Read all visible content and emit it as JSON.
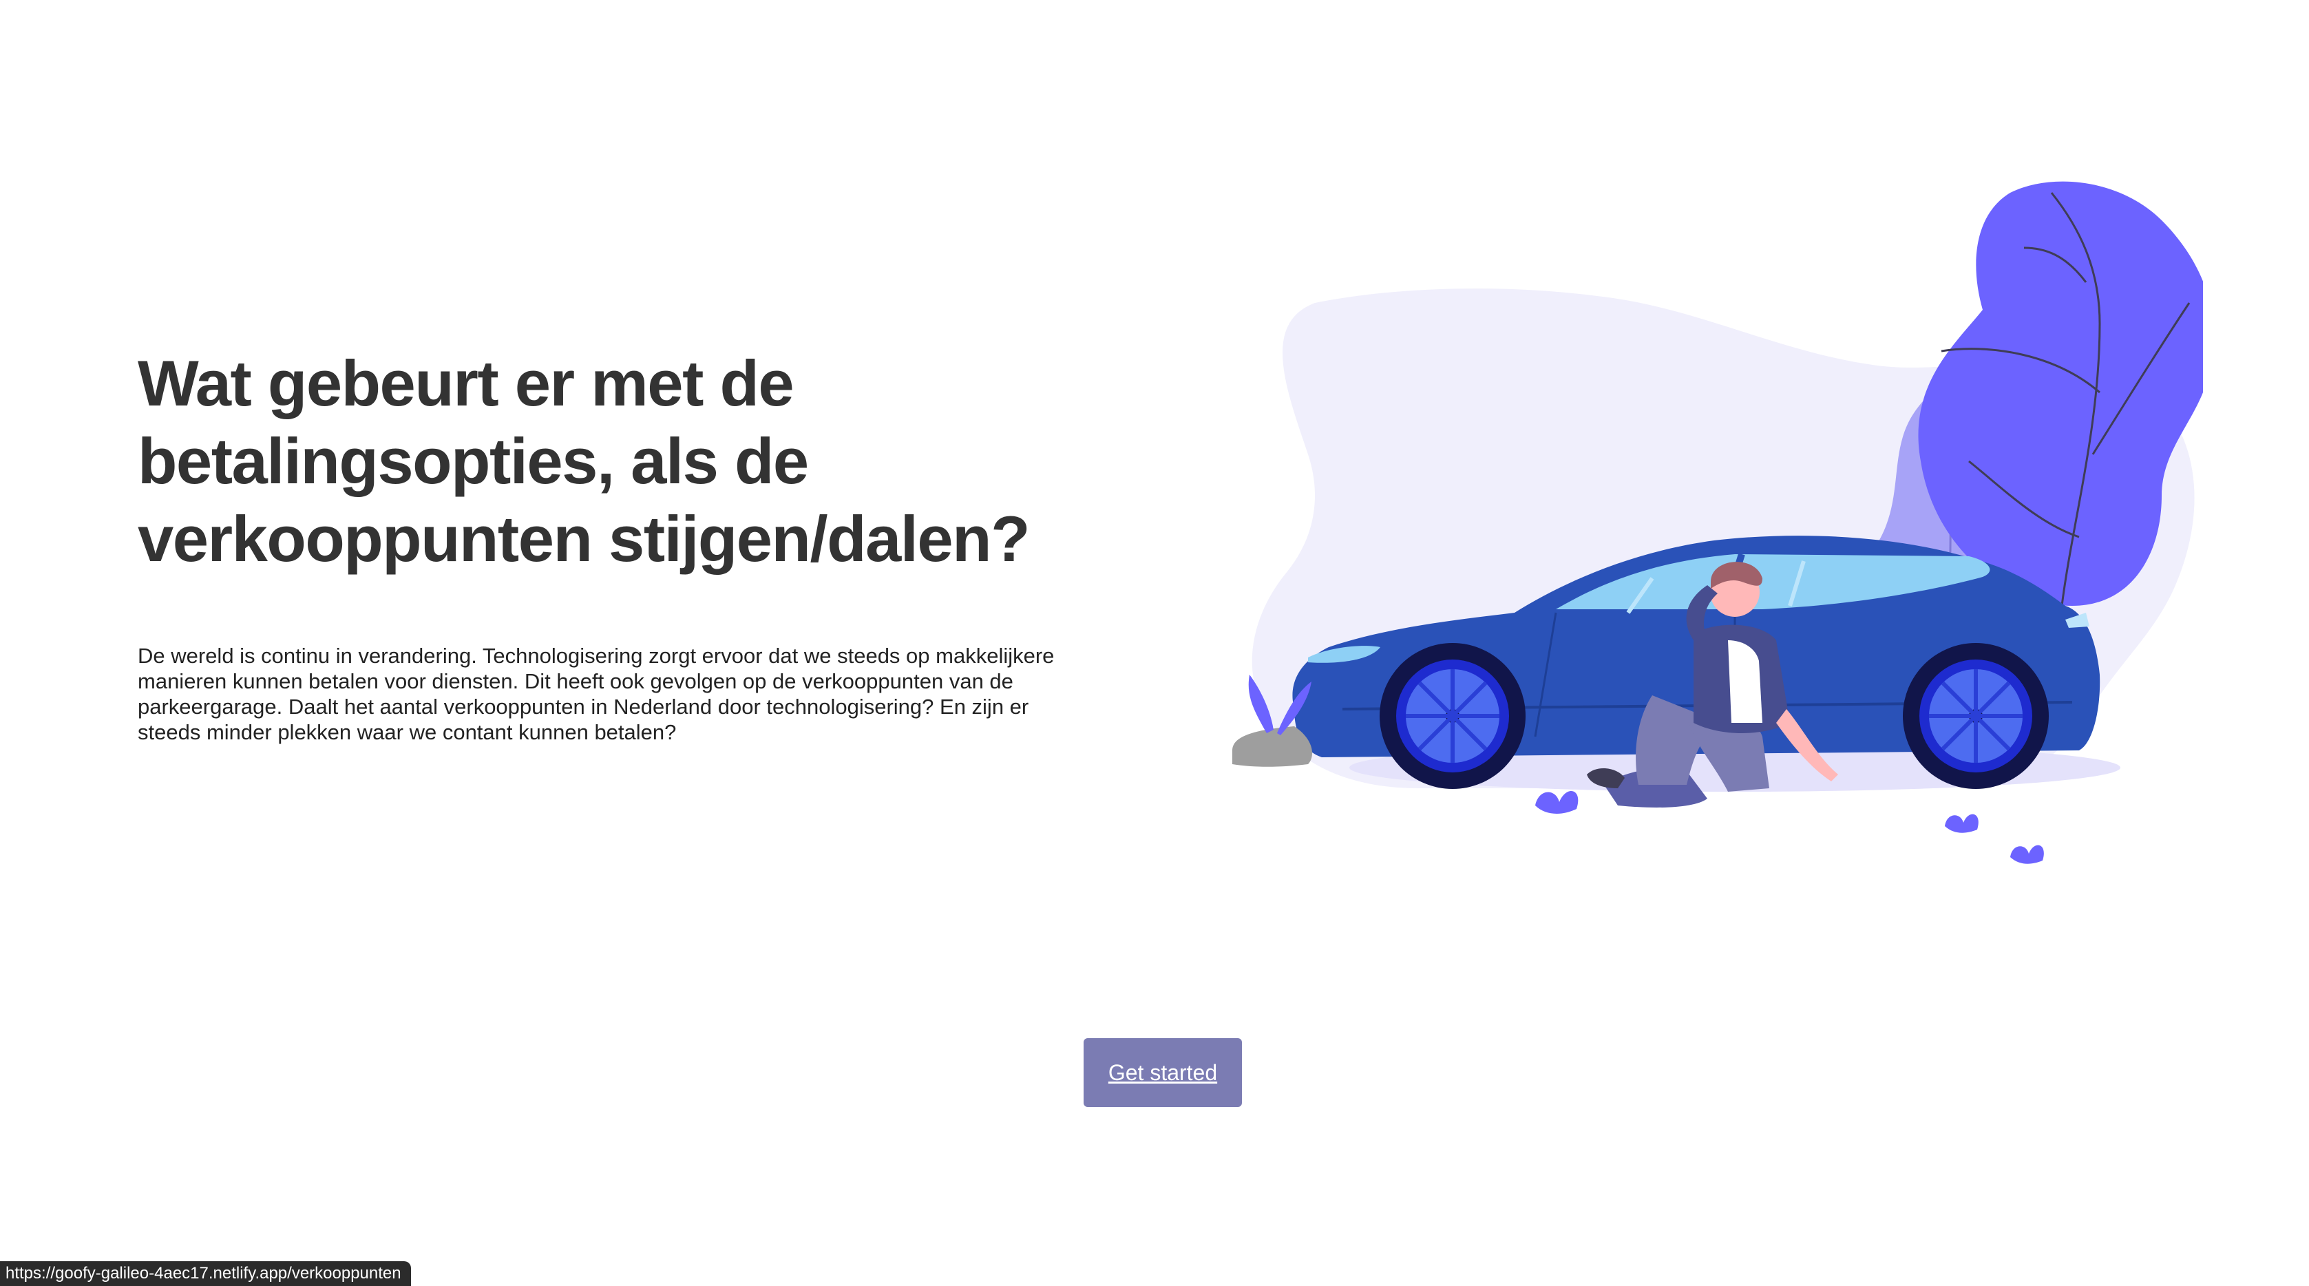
{
  "hero": {
    "title": "Wat gebeurt er met de\nbetalingsopties, als de\nverkooppunten stijgen/dalen?",
    "description": "De wereld is continu in verandering. Technologisering zorgt ervoor dat we steeds op makkelijkere manieren kunnen betalen voor diensten. Dit heeft ook gevolgen op de verkooppunten van de parkeergarage. Daalt het aantal verkooppunten in Nederland door technologisering? En zijn er steeds minder plekken waar we contant kunnen betalen?"
  },
  "cta": {
    "label": "Get started"
  },
  "status_bar": {
    "url": "https://goofy-galileo-4aec17.netlify.app/verkooppunten"
  },
  "colors": {
    "heading": "#333333",
    "button": "#7b7cb3",
    "car": "#2a52b8",
    "leaf": "#6c63ff",
    "blob": "#f0effc"
  }
}
